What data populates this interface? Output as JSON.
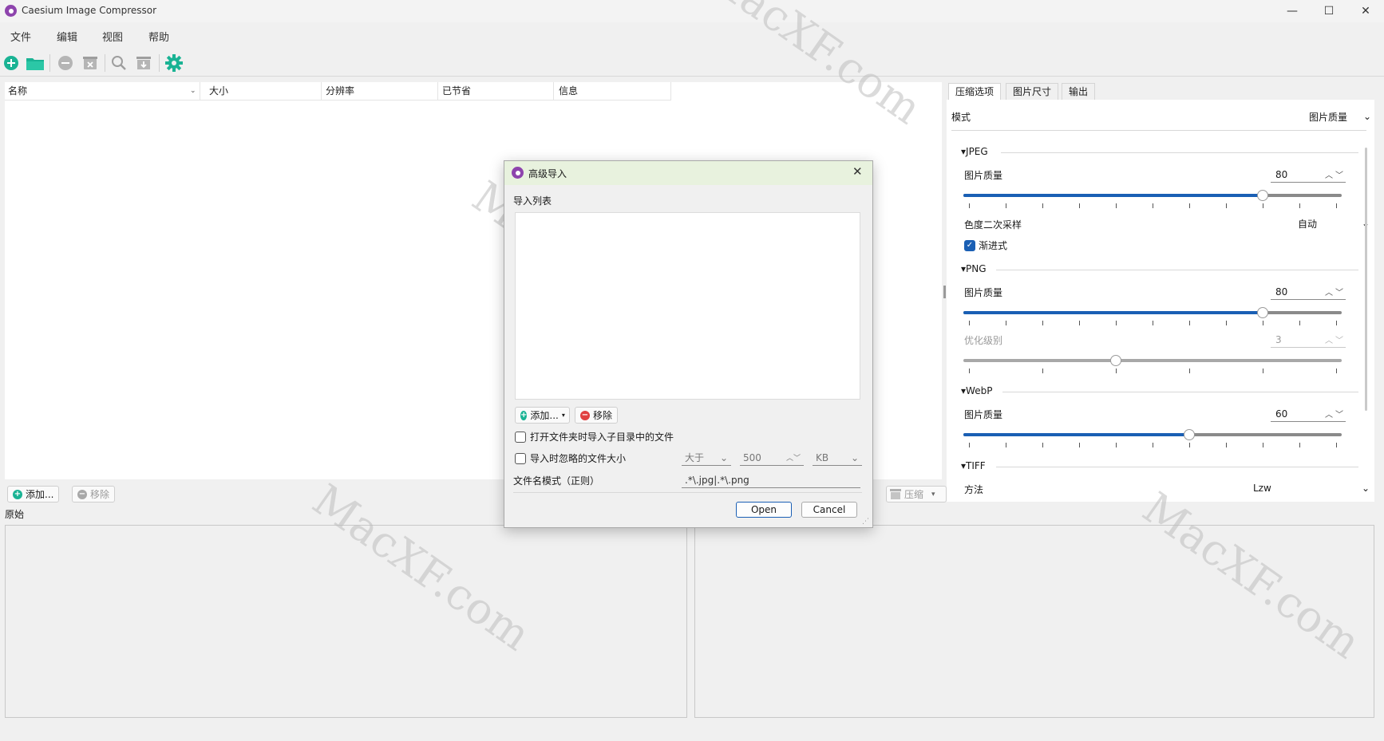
{
  "window": {
    "title": "Caesium Image Compressor",
    "minimize": "—",
    "maximize": "☐",
    "close": "✕"
  },
  "menu": [
    "文件",
    "编辑",
    "视图",
    "帮助"
  ],
  "table": {
    "columns": [
      "名称",
      "大小",
      "分辨率",
      "已节省",
      "信息"
    ]
  },
  "list_actions": {
    "add": "添加...",
    "remove": "移除"
  },
  "preview": {
    "original_label": "原始"
  },
  "compress_button": "压缩",
  "tabs": [
    "压缩选项",
    "图片尺寸",
    "输出"
  ],
  "settings": {
    "mode_label": "模式",
    "mode_value": "图片质量",
    "jpeg": {
      "header": "JPEG",
      "quality_label": "图片质量",
      "quality_value": "80",
      "quality": 80,
      "chroma_label": "色度二次采样",
      "chroma_value": "自动",
      "progressive_label": "渐进式",
      "progressive": true
    },
    "png": {
      "header": "PNG",
      "quality_label": "图片质量",
      "quality_value": "80",
      "quality": 80,
      "optimization_label": "优化级别",
      "optimization_value": "3",
      "optimization_fraction": 0.4
    },
    "webp": {
      "header": "WebP",
      "quality_label": "图片质量",
      "quality_value": "60",
      "quality": 60
    },
    "tiff": {
      "header": "TIFF",
      "method_label": "方法",
      "method_value": "Lzw"
    }
  },
  "dialog": {
    "title": "高级导入",
    "list_label": "导入列表",
    "add": "添加...",
    "remove": "移除",
    "subfolders": "打开文件夹时导入子目录中的文件",
    "ignore_size": "导入时忽略的文件大小",
    "size_op": "大于",
    "size_value": "500",
    "size_unit": "KB",
    "pattern_label": "文件名模式（正则）",
    "pattern_value": ".*\\.jpg|.*\\.png",
    "open": "Open",
    "cancel": "Cancel"
  },
  "watermark": "MacXF.com",
  "colors": {
    "accent": "#1a5fb4",
    "green": "#1ab394",
    "dialog_header": "#e8f2de"
  }
}
